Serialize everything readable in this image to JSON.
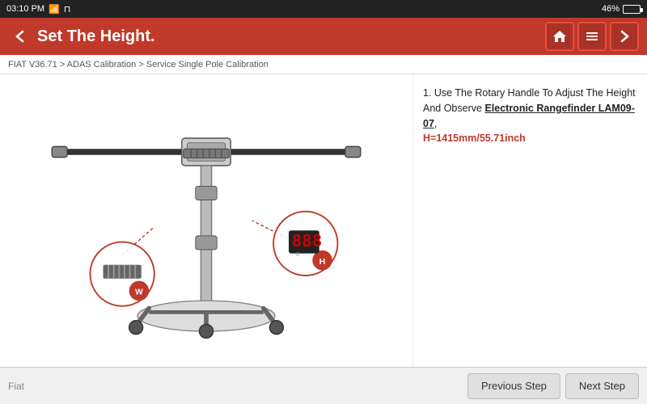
{
  "statusBar": {
    "time": "03:10 PM",
    "signalIcon": "wifi",
    "batteryPercent": "46%"
  },
  "header": {
    "backIcon": "←",
    "title": "Set The Height.",
    "homeIcon": "⌂",
    "menuIcon": "☰",
    "forwardIcon": "→"
  },
  "breadcrumb": {
    "text": "FIAT V36.71 > ADAS Calibration > Service Single Pole Calibration"
  },
  "infopanel": {
    "instruction": "1. Use The Rotary Handle To Adjust The Height And Observe ",
    "linkText": "Electronic Rangefinder LAM09-07",
    "heightText": "H=1415mm/55.71inch"
  },
  "footer": {
    "brand": "Fiat",
    "prevBtn": "Previous Step",
    "nextBtn": "Next Step"
  }
}
